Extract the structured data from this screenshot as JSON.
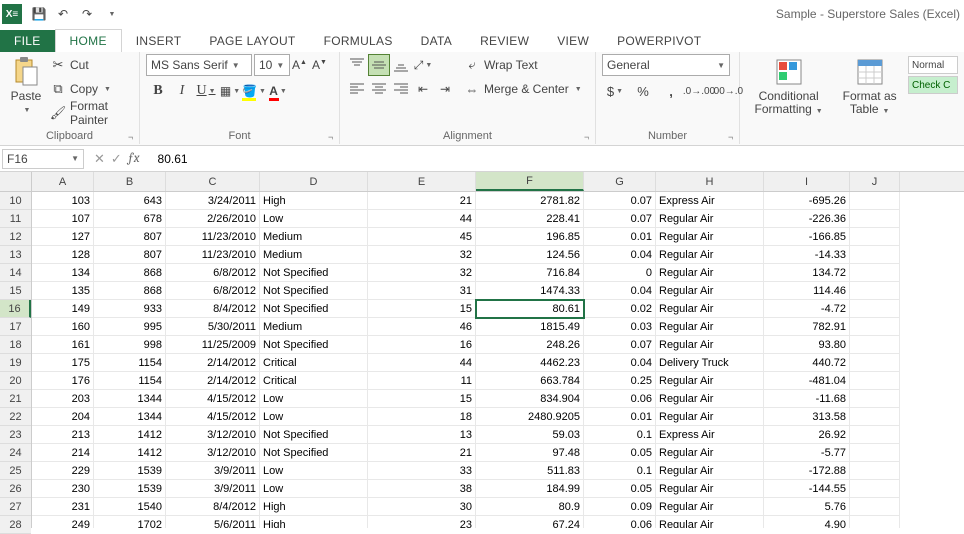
{
  "title": "Sample - Superstore Sales (Excel)",
  "qat": {
    "save": "💾",
    "undo": "↶",
    "redo": "↷"
  },
  "tabs": [
    "FILE",
    "HOME",
    "INSERT",
    "PAGE LAYOUT",
    "FORMULAS",
    "DATA",
    "REVIEW",
    "VIEW",
    "POWERPIVOT"
  ],
  "active_tab": "HOME",
  "ribbon": {
    "clipboard": {
      "label": "Clipboard",
      "paste": "Paste",
      "cut": "Cut",
      "copy": "Copy",
      "fmtpainter": "Format Painter"
    },
    "font": {
      "label": "Font",
      "name": "MS Sans Serif",
      "size": "10"
    },
    "alignment": {
      "label": "Alignment",
      "wrap": "Wrap Text",
      "merge": "Merge & Center"
    },
    "number": {
      "label": "Number",
      "format": "General"
    },
    "styles": {
      "cond": "Conditional Formatting",
      "table": "Format as Table",
      "normal": "Normal",
      "check": "Check C"
    }
  },
  "formula_bar": {
    "cell_ref": "F16",
    "value": "80.61"
  },
  "columns": [
    {
      "key": "A",
      "w": 62
    },
    {
      "key": "B",
      "w": 72
    },
    {
      "key": "C",
      "w": 94
    },
    {
      "key": "D",
      "w": 108
    },
    {
      "key": "E",
      "w": 108
    },
    {
      "key": "F",
      "w": 108
    },
    {
      "key": "G",
      "w": 72
    },
    {
      "key": "H",
      "w": 108
    },
    {
      "key": "I",
      "w": 86
    },
    {
      "key": "J",
      "w": 50
    }
  ],
  "active_cell": {
    "row": 16,
    "col": "F"
  },
  "rows": [
    {
      "n": 10,
      "A": 103,
      "B": 643,
      "C": "3/24/2011",
      "D": "High",
      "E": 21,
      "F": 2781.82,
      "G": 0.07,
      "H": "Express Air",
      "I": -695.26
    },
    {
      "n": 11,
      "A": 107,
      "B": 678,
      "C": "2/26/2010",
      "D": "Low",
      "E": 44,
      "F": 228.41,
      "G": 0.07,
      "H": "Regular Air",
      "I": -226.36
    },
    {
      "n": 12,
      "A": 127,
      "B": 807,
      "C": "11/23/2010",
      "D": "Medium",
      "E": 45,
      "F": 196.85,
      "G": 0.01,
      "H": "Regular Air",
      "I": -166.85
    },
    {
      "n": 13,
      "A": 128,
      "B": 807,
      "C": "11/23/2010",
      "D": "Medium",
      "E": 32,
      "F": 124.56,
      "G": 0.04,
      "H": "Regular Air",
      "I": -14.33
    },
    {
      "n": 14,
      "A": 134,
      "B": 868,
      "C": "6/8/2012",
      "D": "Not Specified",
      "E": 32,
      "F": 716.84,
      "G": 0,
      "H": "Regular Air",
      "I": 134.72
    },
    {
      "n": 15,
      "A": 135,
      "B": 868,
      "C": "6/8/2012",
      "D": "Not Specified",
      "E": 31,
      "F": 1474.33,
      "G": 0.04,
      "H": "Regular Air",
      "I": 114.46
    },
    {
      "n": 16,
      "A": 149,
      "B": 933,
      "C": "8/4/2012",
      "D": "Not Specified",
      "E": 15,
      "F": 80.61,
      "G": 0.02,
      "H": "Regular Air",
      "I": -4.72
    },
    {
      "n": 17,
      "A": 160,
      "B": 995,
      "C": "5/30/2011",
      "D": "Medium",
      "E": 46,
      "F": 1815.49,
      "G": 0.03,
      "H": "Regular Air",
      "I": 782.91
    },
    {
      "n": 18,
      "A": 161,
      "B": 998,
      "C": "11/25/2009",
      "D": "Not Specified",
      "E": 16,
      "F": 248.26,
      "G": 0.07,
      "H": "Regular Air",
      "I": "93.80"
    },
    {
      "n": 19,
      "A": 175,
      "B": 1154,
      "C": "2/14/2012",
      "D": "Critical",
      "E": 44,
      "F": 4462.23,
      "G": 0.04,
      "H": "Delivery Truck",
      "I": 440.72
    },
    {
      "n": 20,
      "A": 176,
      "B": 1154,
      "C": "2/14/2012",
      "D": "Critical",
      "E": 11,
      "F": 663.784,
      "G": 0.25,
      "H": "Regular Air",
      "I": -481.04
    },
    {
      "n": 21,
      "A": 203,
      "B": 1344,
      "C": "4/15/2012",
      "D": "Low",
      "E": 15,
      "F": 834.904,
      "G": 0.06,
      "H": "Regular Air",
      "I": -11.68
    },
    {
      "n": 22,
      "A": 204,
      "B": 1344,
      "C": "4/15/2012",
      "D": "Low",
      "E": 18,
      "F": 2480.9205,
      "G": 0.01,
      "H": "Regular Air",
      "I": 313.58
    },
    {
      "n": 23,
      "A": 213,
      "B": 1412,
      "C": "3/12/2010",
      "D": "Not Specified",
      "E": 13,
      "F": 59.03,
      "G": 0.1,
      "H": "Express Air",
      "I": 26.92
    },
    {
      "n": 24,
      "A": 214,
      "B": 1412,
      "C": "3/12/2010",
      "D": "Not Specified",
      "E": 21,
      "F": 97.48,
      "G": 0.05,
      "H": "Regular Air",
      "I": -5.77
    },
    {
      "n": 25,
      "A": 229,
      "B": 1539,
      "C": "3/9/2011",
      "D": "Low",
      "E": 33,
      "F": 511.83,
      "G": 0.1,
      "H": "Regular Air",
      "I": -172.88
    },
    {
      "n": 26,
      "A": 230,
      "B": 1539,
      "C": "3/9/2011",
      "D": "Low",
      "E": 38,
      "F": 184.99,
      "G": 0.05,
      "H": "Regular Air",
      "I": -144.55
    },
    {
      "n": 27,
      "A": 231,
      "B": 1540,
      "C": "8/4/2012",
      "D": "High",
      "E": 30,
      "F": 80.9,
      "G": 0.09,
      "H": "Regular Air",
      "I": 5.76
    },
    {
      "n": 28,
      "A": 249,
      "B": 1702,
      "C": "5/6/2011",
      "D": "High",
      "E": 23,
      "F": 67.24,
      "G": 0.06,
      "H": "Regular Air",
      "I": "4.90"
    }
  ]
}
